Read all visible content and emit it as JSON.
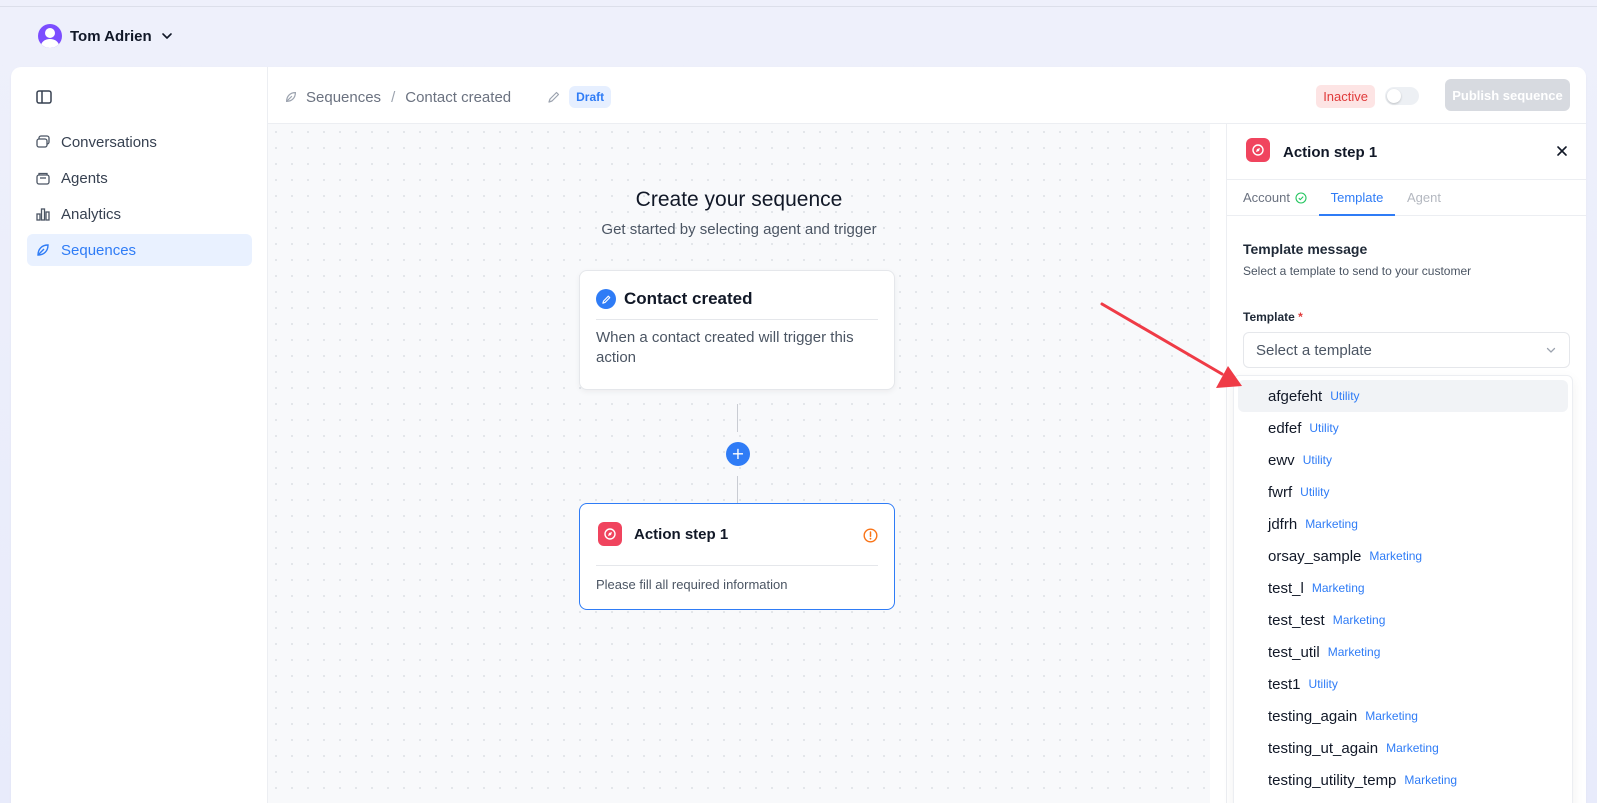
{
  "user": {
    "name": "Tom Adrien"
  },
  "sidebar": {
    "items": [
      {
        "label": "Conversations",
        "icon": "chat-bubbles-icon",
        "active": false
      },
      {
        "label": "Agents",
        "icon": "stack-icon",
        "active": false
      },
      {
        "label": "Analytics",
        "icon": "bar-chart-icon",
        "active": false
      },
      {
        "label": "Sequences",
        "icon": "leaf-icon",
        "active": true
      }
    ]
  },
  "header": {
    "breadcrumb": [
      "Sequences",
      "Contact created"
    ],
    "separator": "/",
    "status_badge": "Draft",
    "inactive_label": "Inactive",
    "publish_label": "Publish sequence"
  },
  "canvas": {
    "title": "Create your sequence",
    "subtitle": "Get started by selecting agent and trigger",
    "trigger_node": {
      "title": "Contact created",
      "description": "When a contact created will trigger this action"
    },
    "add_symbol": "+",
    "action_node": {
      "title": "Action step 1",
      "description": "Please fill all required information"
    }
  },
  "panel": {
    "title": "Action step 1",
    "tabs": [
      {
        "label": "Account",
        "state": "completed"
      },
      {
        "label": "Template",
        "state": "active"
      },
      {
        "label": "Agent",
        "state": "disabled"
      }
    ],
    "section_title": "Template message",
    "section_subtitle": "Select a template to send to your customer",
    "field_label": "Template",
    "required_mark": "*",
    "placeholder": "Select a template",
    "options": [
      {
        "name": "afgefeht",
        "category": "Utility"
      },
      {
        "name": "edfef",
        "category": "Utility"
      },
      {
        "name": "ewv",
        "category": "Utility"
      },
      {
        "name": "fwrf",
        "category": "Utility"
      },
      {
        "name": "jdfrh",
        "category": "Marketing"
      },
      {
        "name": "orsay_sample",
        "category": "Marketing"
      },
      {
        "name": "test_l",
        "category": "Marketing"
      },
      {
        "name": "test_test",
        "category": "Marketing"
      },
      {
        "name": "test_util",
        "category": "Marketing"
      },
      {
        "name": "test1",
        "category": "Utility"
      },
      {
        "name": "testing_again",
        "category": "Marketing"
      },
      {
        "name": "testing_ut_again",
        "category": "Marketing"
      },
      {
        "name": "testing_utility_temp",
        "category": "Marketing"
      }
    ]
  },
  "colors": {
    "accent": "#2f7cf6",
    "danger": "#e03b3b",
    "action_icon": "#f0445e",
    "annotation_arrow": "#ef3b46"
  }
}
